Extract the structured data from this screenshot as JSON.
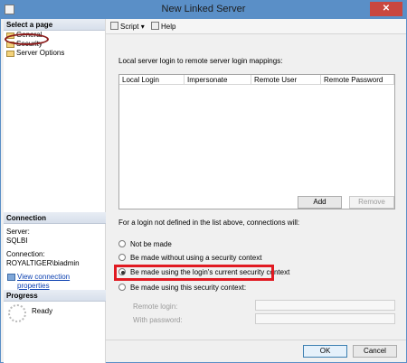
{
  "window": {
    "title": "New Linked Server",
    "close_glyph": "✕"
  },
  "left": {
    "select_page_heading": "Select a page",
    "nav": [
      {
        "label": "General"
      },
      {
        "label": "Security"
      },
      {
        "label": "Server Options"
      }
    ],
    "connection_heading": "Connection",
    "server_label": "Server:",
    "server_value": "SQLBI",
    "connection_label": "Connection:",
    "connection_value": "ROYALTIGER\\biadmin",
    "view_props_link": "View connection properties",
    "progress_heading": "Progress",
    "progress_status": "Ready"
  },
  "toolbar": {
    "script_label": "Script",
    "help_label": "Help",
    "dropdown_glyph": "▾"
  },
  "mappings": {
    "caption": "Local server login to remote server login mappings:",
    "columns": [
      "Local Login",
      "Impersonate",
      "Remote User",
      "Remote Password"
    ],
    "add_label": "Add",
    "remove_label": "Remove"
  },
  "not_defined": {
    "label": "For a login not defined in the list above, connections will:",
    "options": [
      {
        "label": "Not be made",
        "selected": false
      },
      {
        "label": "Be made without using a security context",
        "selected": false
      },
      {
        "label": "Be made using the login's current security context",
        "selected": true
      },
      {
        "label": "Be made using this security context:",
        "selected": false
      }
    ],
    "remote_login_label": "Remote login:",
    "password_label": "With password:"
  },
  "footer": {
    "ok_label": "OK",
    "cancel_label": "Cancel"
  },
  "colors": {
    "title_bar": "#5a8fc7",
    "highlight_rect": "#e11a22",
    "highlight_oval": "#8b1b1b",
    "link": "#0a3fb0"
  }
}
